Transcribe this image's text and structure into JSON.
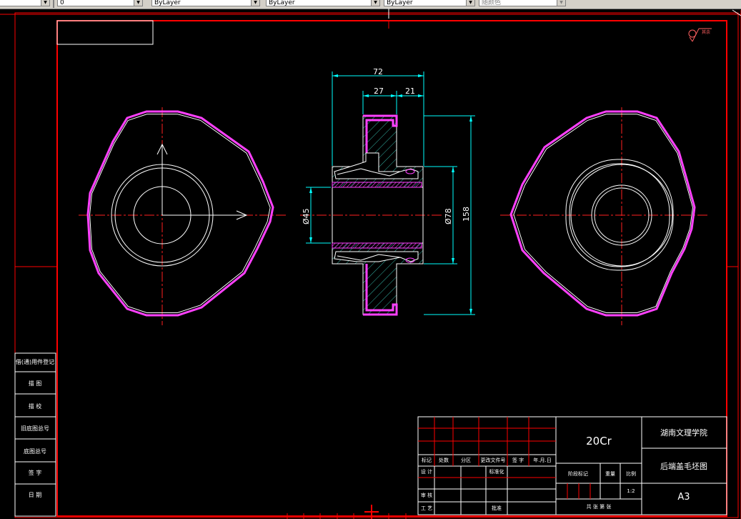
{
  "toolbar": {
    "layer_value": "0",
    "color_value": "ByLayer",
    "linetype_value": "ByLayer",
    "lineweight_value": "ByLayer",
    "plotstyle_value": "随颜色"
  },
  "drawing": {
    "dims": {
      "overall_width": "72",
      "hub_width": "27",
      "flange_width": "21",
      "bore_dia": "Ø45",
      "hub_dia": "Ø78",
      "outer_dia": "158"
    },
    "roughness_note": "其余"
  },
  "title_block": {
    "material": "20Cr",
    "school": "湖南文理学院",
    "drawing_name": "后端盖毛坯图",
    "sheet_size": "A3",
    "scale_value": "1:2",
    "rev_headers": [
      "标记",
      "处数",
      "分区",
      "更改文件号",
      "签 字",
      "年.月.日"
    ],
    "row_design": "设 计",
    "row_standard": "标准化",
    "row_review": "审 核",
    "row_process": "工 艺",
    "row_approve": "批准",
    "stage_label": "阶段标记",
    "weight_label": "重量",
    "scale_label": "比例",
    "sheets_label": "共   张   第   张"
  },
  "side_labels": [
    "借(通)用件登记",
    "描  图",
    "描  校",
    "旧底图总号",
    "底图总号",
    "签  字",
    "日  期"
  ],
  "colors": {
    "background": "#000000",
    "frame": "#ff0000",
    "centerline": "#ff2020",
    "outline": "#ffffff",
    "hatch": "#40e0d0",
    "dimension": "#00ffff",
    "magenta": "#ff40ff"
  }
}
